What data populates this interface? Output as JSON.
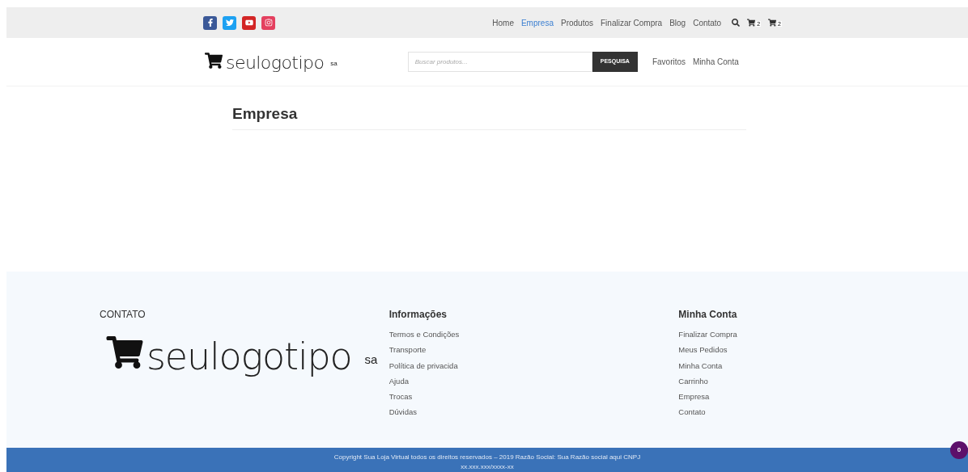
{
  "top_bar": {
    "social": [
      {
        "kind": "facebook"
      },
      {
        "kind": "twitter"
      },
      {
        "kind": "youtube"
      },
      {
        "kind": "instagram"
      }
    ],
    "nav": [
      {
        "label": "Home",
        "selected": false
      },
      {
        "label": "Empresa",
        "selected": true
      },
      {
        "label": "Produtos",
        "selected": false
      },
      {
        "label": "Finalizar Compra",
        "selected": false
      },
      {
        "label": "Blog",
        "selected": false
      },
      {
        "label": "Contato",
        "selected": false
      }
    ],
    "carts": [
      {
        "count": "2"
      },
      {
        "count": "2"
      }
    ]
  },
  "header": {
    "logo": {
      "text": "seulogotipo",
      "suffix": "sa"
    },
    "search": {
      "placeholder": "Buscar produtos...",
      "button": "PESQUISA"
    },
    "links": [
      "Favoritos",
      "Minha Conta"
    ]
  },
  "page": {
    "title": "Empresa"
  },
  "footer": {
    "contact": {
      "heading": "CONTATO",
      "logo": {
        "text": "seulogotipo",
        "suffix": "sa"
      }
    },
    "columns": [
      {
        "heading": "Informações",
        "links": [
          "Termos e Condições",
          "Transporte",
          "Política de privacida",
          "Ajuda",
          "Trocas",
          "Dúvidas"
        ]
      },
      {
        "heading": "Minha Conta",
        "links": [
          "Finalizar Compra",
          "Meus Pedidos",
          "Minha Conta",
          "Carrinho",
          "Empresa",
          "Contato"
        ]
      }
    ]
  },
  "copyright": {
    "lines": [
      "Copyright Sua Loja Virtual todos os direitos reservados – 2019 Razão Social: Sua Razão social aqui CNPJ",
      "xx.xxx.xxx/xxxx-xx"
    ]
  },
  "cart_badge": "0"
}
